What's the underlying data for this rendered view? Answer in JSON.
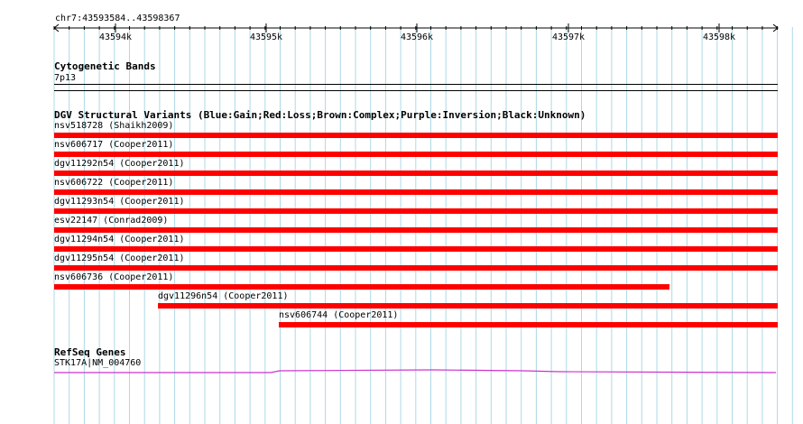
{
  "ruler": {
    "coordinate": "chr7:43593584..43598367",
    "ticks": [
      "43594k",
      "43595k",
      "43596k",
      "43597k",
      "43598k"
    ]
  },
  "tracks": {
    "cytoband": {
      "title": "Cytogenetic Bands",
      "band": "7p13"
    },
    "dgv": {
      "title": "DGV Structural Variants (Blue:Gain;Red:Loss;Brown:Complex;Purple:Inversion;Black:Unknown)",
      "loss_color": "#ff0000",
      "items": [
        {
          "label": "nsv518728 (Shaikh2009)"
        },
        {
          "label": "nsv606717 (Cooper2011)"
        },
        {
          "label": "dgv11292n54 (Cooper2011)"
        },
        {
          "label": "nsv606722 (Cooper2011)"
        },
        {
          "label": "dgv11293n54 (Cooper2011)"
        },
        {
          "label": "esv22147 (Conrad2009)"
        },
        {
          "label": "dgv11294n54 (Cooper2011)"
        },
        {
          "label": "dgv11295n54 (Cooper2011)"
        },
        {
          "label": "nsv606736 (Cooper2011)"
        },
        {
          "label": "dgv11296n54 (Cooper2011)"
        },
        {
          "label": "nsv606744 (Cooper2011)"
        }
      ]
    },
    "refseq": {
      "title": "RefSeq Genes",
      "gene": "STK17A|NM_004760",
      "color": "#cc33cc"
    }
  },
  "grid_color": "#add8e6"
}
